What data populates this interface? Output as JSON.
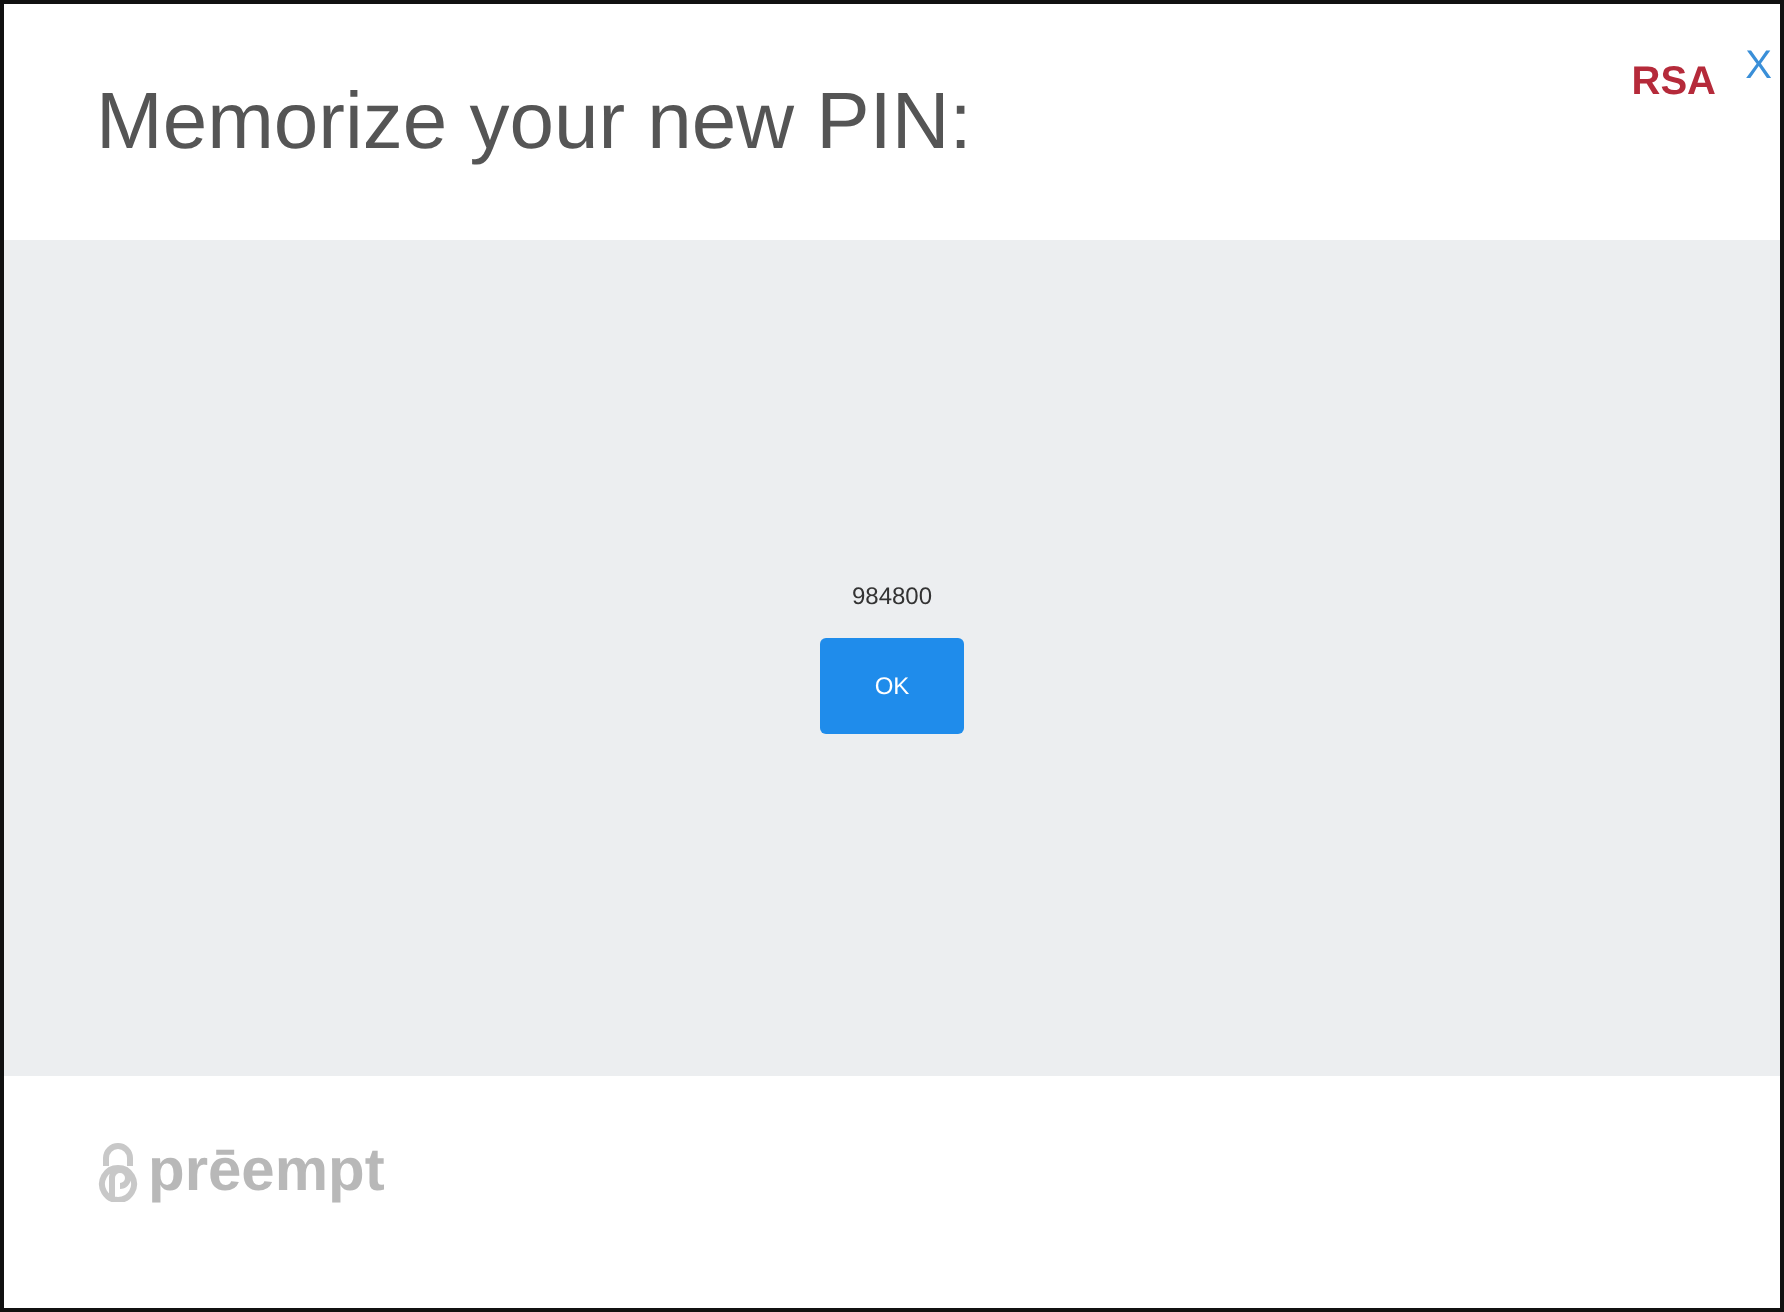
{
  "header": {
    "title": "Memorize your new PIN:",
    "logo": "RSA",
    "close": "X"
  },
  "body": {
    "pin": "984800",
    "button": "OK"
  },
  "footer": {
    "brand": "prēempt"
  }
}
